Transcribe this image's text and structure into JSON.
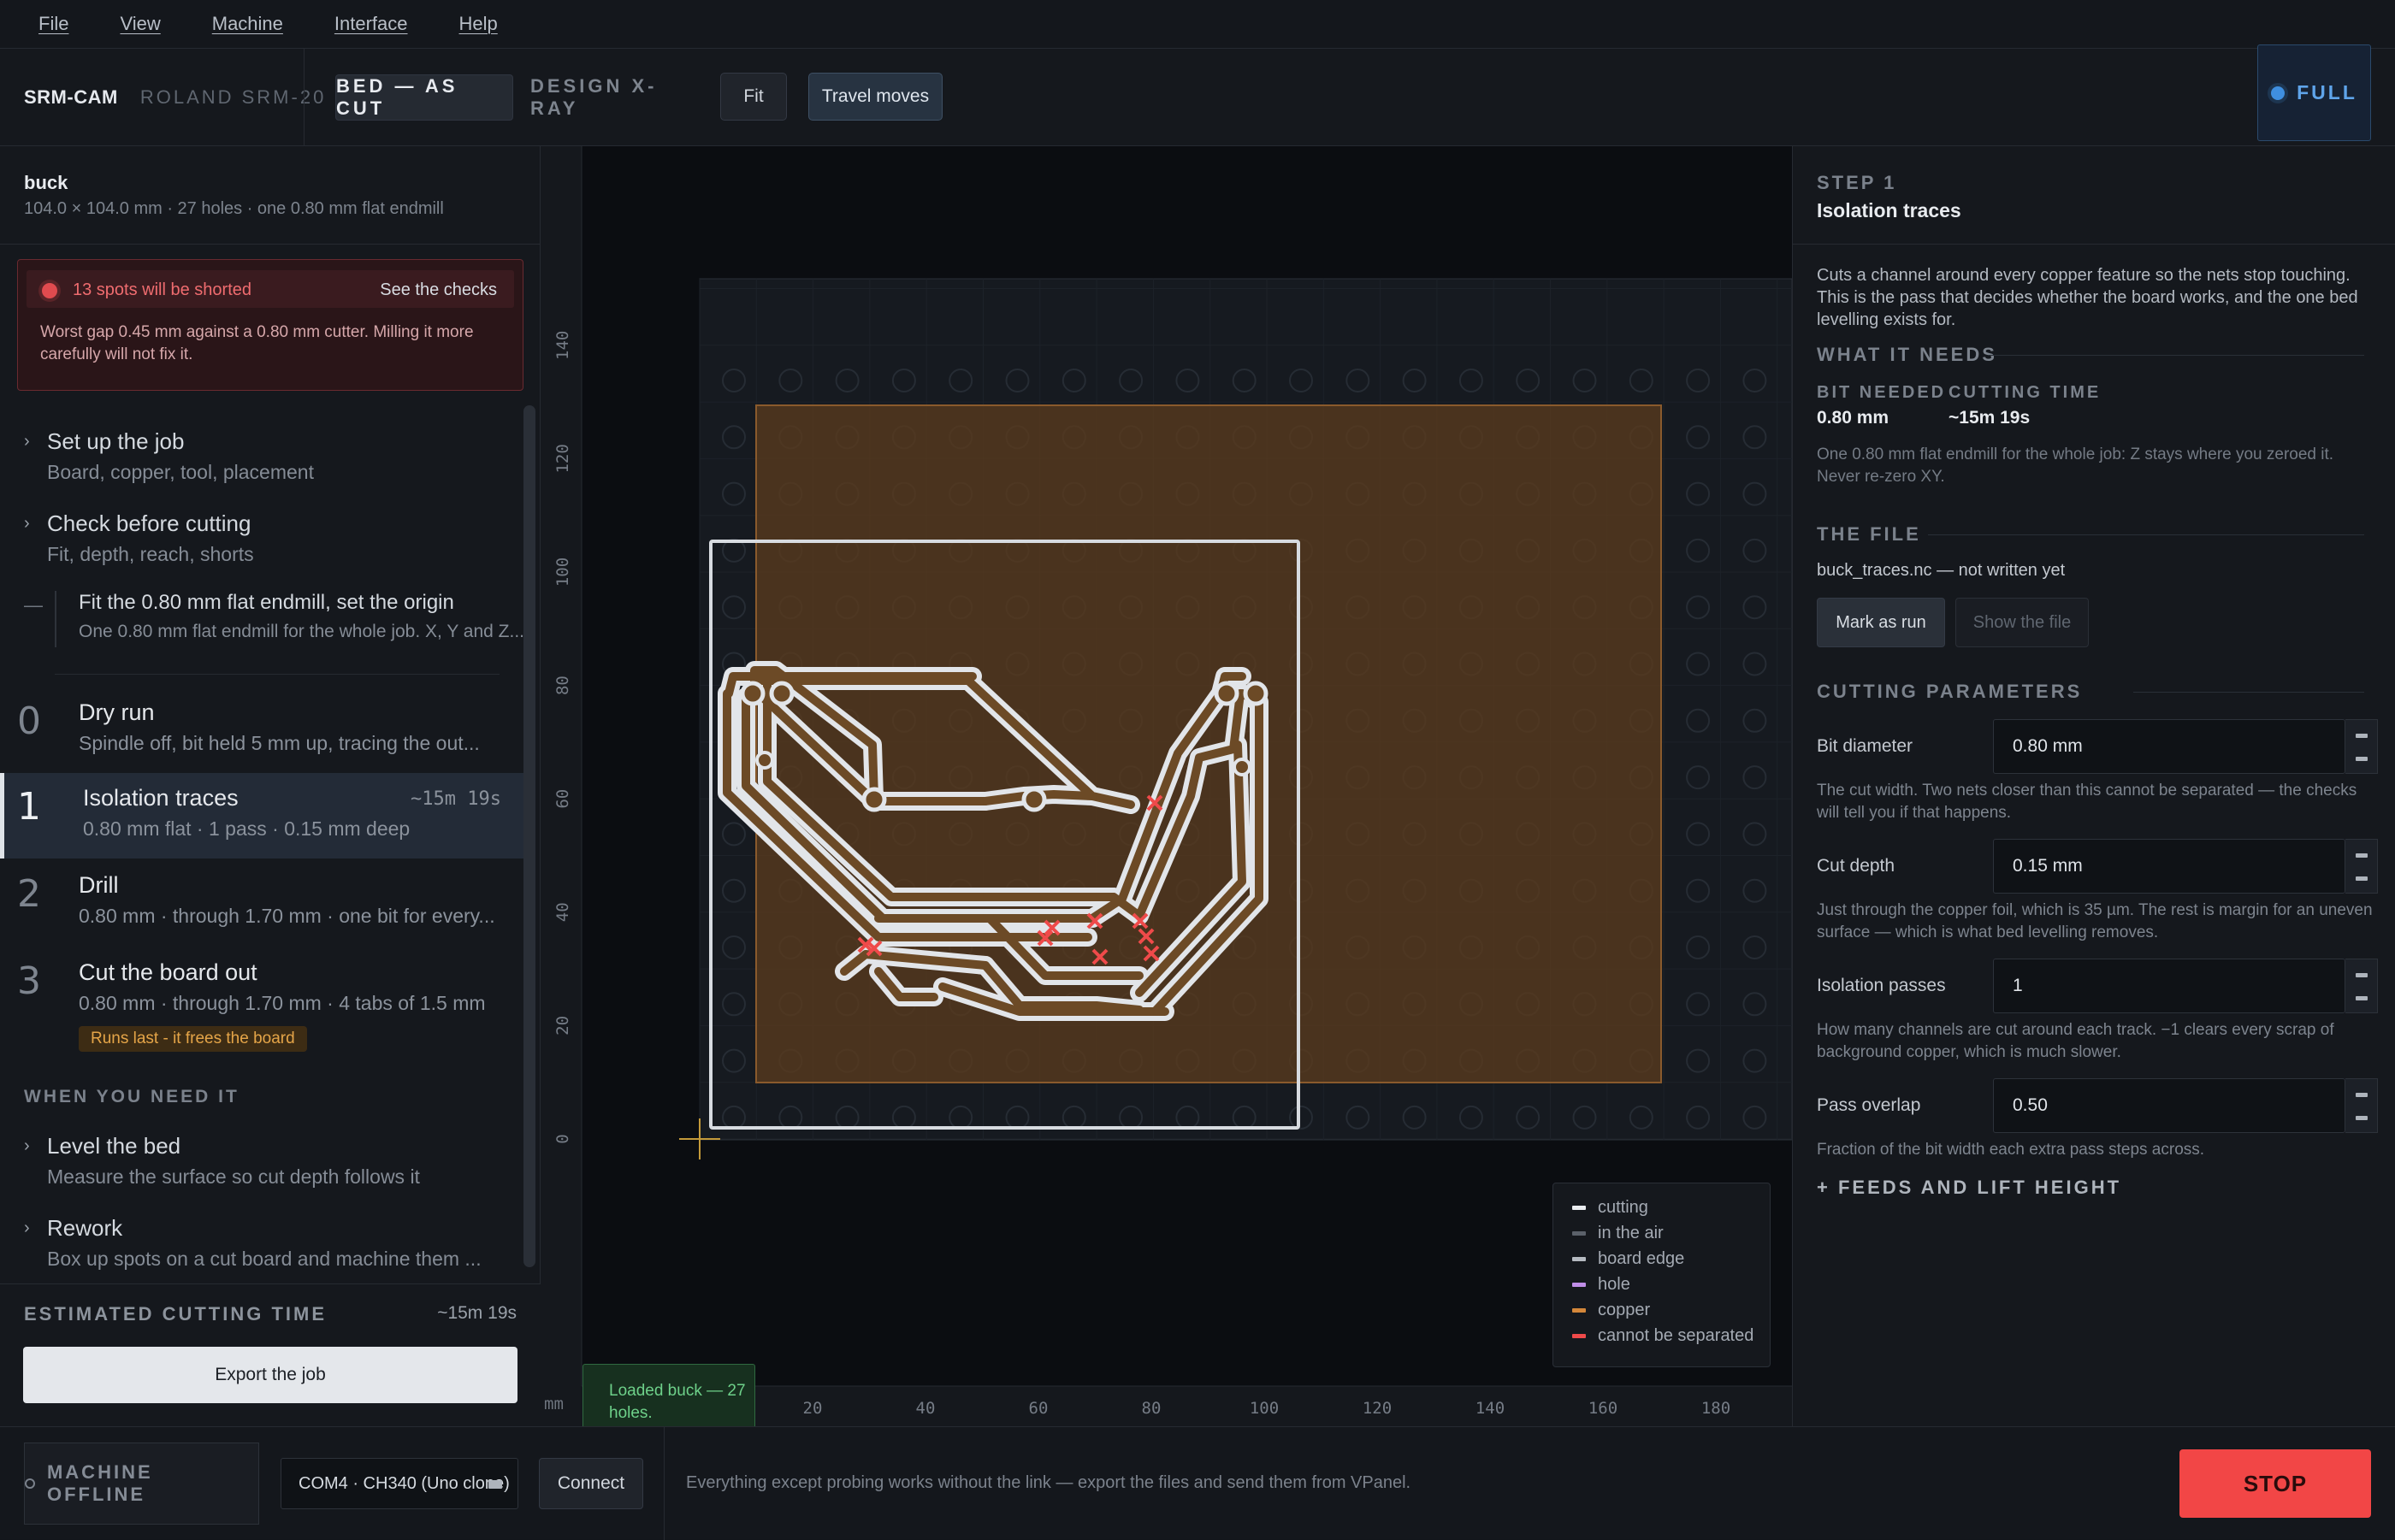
{
  "menu": [
    "File",
    "View",
    "Machine",
    "Interface",
    "Help"
  ],
  "toolbar": {
    "app": "SRM-CAM",
    "machine": "ROLAND SRM-20",
    "view_tab_active": "BED — AS CUT",
    "view_tab_inactive": "DESIGN X-RAY",
    "fit": "Fit",
    "travel": "Travel moves",
    "full": "FULL"
  },
  "job": {
    "name": "buck",
    "meta": "104.0 × 104.0 mm · 27 holes · one 0.80 mm flat endmill"
  },
  "alert": {
    "head": "13 spots will be shorted",
    "link": "See the checks",
    "body": "Worst gap 0.45 mm against a 0.80 mm cutter. Milling it more carefully will not fix it."
  },
  "groups": {
    "setup": {
      "title": "Set up the job",
      "sub": "Board, copper, tool, placement"
    },
    "check": {
      "title": "Check before cutting",
      "sub": "Fit, depth, reach, shorts"
    },
    "fit": {
      "title": "Fit the 0.80 mm flat endmill, set the origin",
      "sub": "One 0.80 mm flat endmill for the whole job. X, Y and Z..."
    }
  },
  "steps": [
    {
      "num": "0",
      "title": "Dry run",
      "sub": "Spindle off, bit held 5 mm up, tracing the out..."
    },
    {
      "num": "1",
      "title": "Isolation traces",
      "sub": "0.80 mm flat · 1 pass · 0.15 mm deep",
      "time": "~15m 19s"
    },
    {
      "num": "2",
      "title": "Drill",
      "sub": "0.80 mm · through 1.70 mm · one bit for every..."
    },
    {
      "num": "3",
      "title": "Cut the board out",
      "sub": "0.80 mm · through 1.70 mm · 4 tabs of 1.5 mm",
      "badge": "Runs last - it frees the board"
    }
  ],
  "when_head": "WHEN YOU NEED IT",
  "when": {
    "level": {
      "title": "Level the bed",
      "sub": "Measure the surface so cut depth follows it"
    },
    "rework": {
      "title": "Rework",
      "sub": "Box up spots on a cut board and machine them ..."
    }
  },
  "estimate": {
    "label": "ESTIMATED CUTTING TIME",
    "value": "~15m 19s",
    "export": "Export the job"
  },
  "canvas": {
    "unit": "mm",
    "xticks": [
      "20",
      "40",
      "60",
      "80",
      "100",
      "120",
      "140",
      "160",
      "180"
    ],
    "yticks": [
      "0",
      "20",
      "40",
      "60",
      "80",
      "100",
      "120",
      "140"
    ],
    "toast": "Loaded buck — 27 holes."
  },
  "legend": [
    {
      "label": "cutting",
      "color": "#e9ecef"
    },
    {
      "label": "in the air",
      "color": "#5b616a"
    },
    {
      "label": "board edge",
      "color": "#b5bac1"
    },
    {
      "label": "hole",
      "color": "#c08ee8"
    },
    {
      "label": "copper",
      "color": "#d4873a"
    },
    {
      "label": "cannot be separated",
      "color": "#ef4a4a"
    }
  ],
  "right": {
    "step": "STEP 1",
    "title": "Isolation traces",
    "desc": "Cuts a channel around every copper feature so the nets stop touching. This is the pass that decides whether the board works, and the one bed levelling exists for.",
    "needs_head": "WHAT IT NEEDS",
    "bit_label": "BIT NEEDED",
    "bit_value": "0.80 mm",
    "time_label": "CUTTING TIME",
    "time_value": "~15m 19s",
    "needs_note": "One 0.80 mm flat endmill for the whole job: Z stays where you zeroed it. Never re-zero XY.",
    "file_head": "THE FILE",
    "file_name": "buck_traces.nc — not written yet",
    "mark": "Mark as run",
    "show": "Show the file",
    "params_head": "CUTTING PARAMETERS",
    "params": [
      {
        "label": "Bit diameter",
        "value": "0.80 mm",
        "note": "The cut width. Two nets closer than this cannot be separated — the checks will tell you if that happens."
      },
      {
        "label": "Cut depth",
        "value": "0.15 mm",
        "note": "Just through the copper foil, which is 35 µm. The rest is margin for an uneven surface — which is what bed levelling removes."
      },
      {
        "label": "Isolation passes",
        "value": "1",
        "note": "How many channels are cut around each track. −1 clears every scrap of background copper, which is much slower."
      },
      {
        "label": "Pass overlap",
        "value": "0.50",
        "note": "Fraction of the bit width each extra pass steps across."
      }
    ],
    "feeds": "+  FEEDS AND LIFT HEIGHT"
  },
  "status": {
    "offline": "MACHINE OFFLINE",
    "port": "COM4 · CH340 (Uno clone)",
    "connect": "Connect",
    "text": "Everything except probing works without the link — export the files and send them from VPanel.",
    "stop": "STOP"
  }
}
